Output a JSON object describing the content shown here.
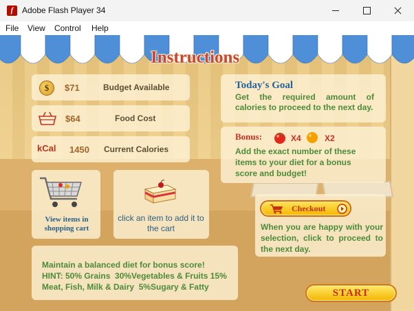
{
  "window": {
    "title": "Adobe Flash Player 34",
    "app_icon_glyph": "f",
    "controls": [
      "minimize-icon",
      "maximize-icon",
      "close-icon"
    ]
  },
  "menu": [
    "File",
    "View",
    "Control",
    "Help"
  ],
  "game": {
    "heading": "Instructions",
    "stats": {
      "budget": {
        "value": "$71",
        "label": "Budget Available",
        "icon": "coin-icon",
        "coin_glyph": "$"
      },
      "food_cost": {
        "value": "$64",
        "label": "Food Cost",
        "icon": "basket-icon"
      },
      "calories": {
        "unit": "kCal",
        "value": "1450",
        "label": "Current Calories"
      }
    },
    "goal": {
      "title": "Today's Goal",
      "text": "Get the required amount of calories to proceed to the next day."
    },
    "bonus": {
      "label": "Bonus:",
      "items": [
        {
          "icon": "tomato-icon",
          "multiplier": "X4"
        },
        {
          "icon": "orange-icon",
          "multiplier": "X2"
        }
      ],
      "text": "Add the exact number of these items to your diet for a bonus score and budget!"
    },
    "cart_tip": {
      "caption": "View items in shopping cart",
      "icon": "shopping-cart-icon"
    },
    "item_tip": {
      "caption": "click an item to add it to the cart",
      "icon": "cake-icon"
    },
    "checkout": {
      "button_label": "Checkout",
      "text": "When you are happy with your selection, click to proceed to the next day."
    },
    "hint": {
      "line1": "Maintain a balanced diet for bonus score!",
      "line2": "HINT: 50% Grains  30%Vegetables & Fruits 15%",
      "line3": "Meat, Fish, Milk & Dairy  5%Sugary & Fatty"
    },
    "start_label": "START",
    "colors": {
      "heading": "#c9453a",
      "goal_title": "#23629c",
      "body_text": "#4d8a3a",
      "bonus_red": "#cc2e1e",
      "button_yellow": "#f5b600"
    }
  }
}
